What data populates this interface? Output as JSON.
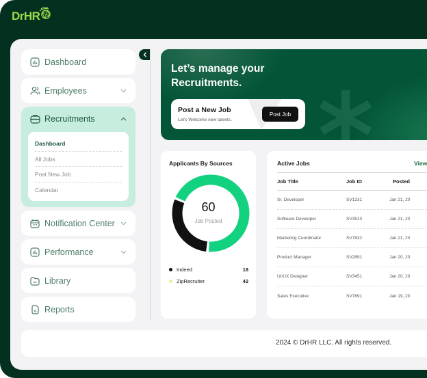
{
  "brand": {
    "name": "DrHR",
    "accent": "#9ddb4a",
    "dark": "#03301f",
    "primary": "#035538"
  },
  "sidebar": {
    "items": [
      {
        "label": "Dashboard",
        "icon": "chart-box-icon",
        "expandable": false
      },
      {
        "label": "Employees",
        "icon": "users-icon",
        "expandable": true,
        "open": false
      },
      {
        "label": "Recruitments",
        "icon": "briefcase-icon",
        "expandable": true,
        "open": true,
        "children": [
          {
            "label": "Dashboard",
            "active": true
          },
          {
            "label": "All Jobs"
          },
          {
            "label": "Post New Job"
          },
          {
            "label": "Calendar"
          }
        ]
      },
      {
        "label": "Notification Center",
        "icon": "calendar-icon",
        "expandable": true,
        "open": false
      },
      {
        "label": "Performance",
        "icon": "chart-box-icon",
        "expandable": true,
        "open": false
      },
      {
        "label": "Library",
        "icon": "folder-icon",
        "expandable": false
      },
      {
        "label": "Reports",
        "icon": "document-icon",
        "expandable": false
      }
    ]
  },
  "banner": {
    "title": "Let’s manage your Recruitments.",
    "card_title": "Post a New Job",
    "card_subtitle": "Let's Welcome new talents.",
    "button_label": "Post Job"
  },
  "applicants": {
    "title": "Applicants By Sources",
    "total": "60",
    "total_label": "Job Posted",
    "sources": [
      {
        "name": "Indeed",
        "value": 18,
        "color": "#111111"
      },
      {
        "name": "ZipRecruiter",
        "value": 42,
        "color": "#12d17f"
      }
    ]
  },
  "active_jobs": {
    "title": "Active Jobs",
    "view_label": "View",
    "columns": [
      "Job Title",
      "Job ID",
      "Posted"
    ],
    "rows": [
      [
        "Sr. Developer",
        "SV1231",
        "Jan 21, 20"
      ],
      [
        "Software Developer",
        "SV3513",
        "Jan 21, 20"
      ],
      [
        "Marketing Coordinator",
        "SV7832",
        "Jan 21, 20"
      ],
      [
        "Product Manager",
        "SV2891",
        "Jan 20, 20"
      ],
      [
        "UI/UX Designer",
        "SV3451",
        "Jan 20, 20"
      ],
      [
        "Sales Executive",
        "SV7891",
        "Jan 19, 20"
      ]
    ]
  },
  "footer": {
    "text": "2024 © DrHR LLC. All rights reserved."
  }
}
